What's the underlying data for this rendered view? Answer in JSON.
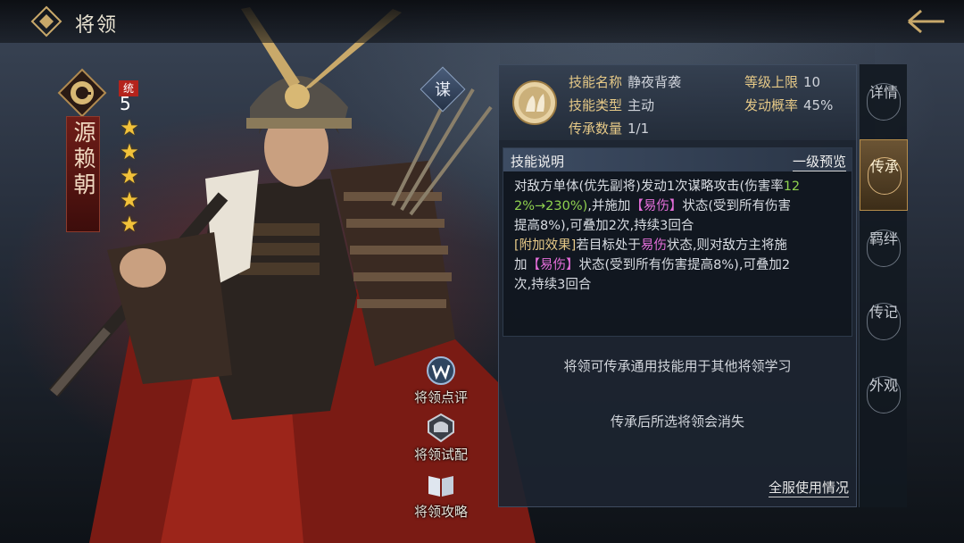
{
  "header": {
    "title": "将领"
  },
  "hero": {
    "name": "源赖朝",
    "command_label": "统",
    "command_value": "5",
    "stars": 5,
    "strategy_tag": "谋"
  },
  "actions": [
    {
      "label": "将领点评",
      "icon": "w-badge-icon"
    },
    {
      "label": "将领试配",
      "icon": "helmet-icon"
    },
    {
      "label": "将领攻略",
      "icon": "book-icon"
    }
  ],
  "skill": {
    "name_label": "技能名称",
    "name": "静夜背袭",
    "type_label": "技能类型",
    "type": "主动",
    "inherit_label": "传承数量",
    "inherit": "1/1",
    "level_label": "等级上限",
    "level": "10",
    "chance_label": "发动概率",
    "chance": "45%"
  },
  "description": {
    "title": "技能说明",
    "preview": "一级预览",
    "line1a": "对敌方单体(优先副将)发动1次谋略攻击(伤害率",
    "line1b": "12",
    "line2a": "2%→230%)",
    "line2b": ",并施加",
    "tag_vuln": "【易伤】",
    "line2c": "状态(受到所有伤害",
    "line3": "提高8%),可叠加2次,持续3回合",
    "extra_tag": "[附加效果]",
    "extra1a": "若目标处于",
    "extra_vuln": "易伤",
    "extra1b": "状态,则对敌方主将施",
    "extra2a": "加",
    "extra2b": "状态(受到所有伤害提高8%),可叠加2",
    "extra3": "次,持续3回合"
  },
  "info": {
    "line1": "将领可传承通用技能用于其他将领学习",
    "line2": "传承后所选将领会消失",
    "usage_link": "全服使用情况"
  },
  "tabs": [
    {
      "label": "详情",
      "active": false
    },
    {
      "label": "传承",
      "active": true
    },
    {
      "label": "羁绊",
      "active": false
    },
    {
      "label": "传记",
      "active": false
    },
    {
      "label": "外观",
      "active": false
    }
  ]
}
